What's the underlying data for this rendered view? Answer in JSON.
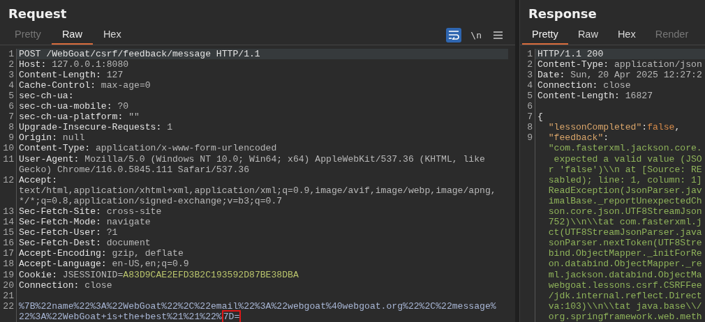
{
  "request": {
    "title": "Request",
    "tabs": [
      {
        "label": "Pretty",
        "selected": false,
        "disabled": true
      },
      {
        "label": "Raw",
        "selected": true,
        "disabled": false
      },
      {
        "label": "Hex",
        "selected": false,
        "disabled": false
      }
    ],
    "toolbar": [
      {
        "kind": "wrap",
        "on": true
      },
      {
        "kind": "newlines",
        "label": "\\n",
        "on": false
      },
      {
        "kind": "menu",
        "on": false
      }
    ],
    "rows": [
      {
        "number": "1",
        "selected": true,
        "segments": [
          {
            "kind": "name",
            "text": "POST /WebGoat/csrf/feedback/message HTTP/1.1"
          }
        ]
      },
      {
        "number": "2",
        "selected": false,
        "segments": [
          {
            "kind": "name",
            "text": "Host:"
          },
          {
            "kind": "value",
            "text": " 127.0.0.1:8080"
          }
        ]
      },
      {
        "number": "3",
        "selected": false,
        "segments": [
          {
            "kind": "name",
            "text": "Content-Length:"
          },
          {
            "kind": "value",
            "text": " 127"
          }
        ]
      },
      {
        "number": "4",
        "selected": false,
        "segments": [
          {
            "kind": "name",
            "text": "Cache-Control:"
          },
          {
            "kind": "value",
            "text": " max-age=0"
          }
        ]
      },
      {
        "number": "5",
        "selected": false,
        "segments": [
          {
            "kind": "name",
            "text": "sec-ch-ua:"
          }
        ]
      },
      {
        "number": "6",
        "selected": false,
        "segments": [
          {
            "kind": "name",
            "text": "sec-ch-ua-mobile:"
          },
          {
            "kind": "value",
            "text": " ?0"
          }
        ]
      },
      {
        "number": "7",
        "selected": false,
        "segments": [
          {
            "kind": "name",
            "text": "sec-ch-ua-platform:"
          },
          {
            "kind": "value",
            "text": " \"\""
          }
        ]
      },
      {
        "number": "8",
        "selected": false,
        "segments": [
          {
            "kind": "name",
            "text": "Upgrade-Insecure-Requests:"
          },
          {
            "kind": "value",
            "text": " 1"
          }
        ]
      },
      {
        "number": "9",
        "selected": false,
        "segments": [
          {
            "kind": "name",
            "text": "Origin:"
          },
          {
            "kind": "value",
            "text": " null"
          }
        ]
      },
      {
        "number": "10",
        "selected": false,
        "segments": [
          {
            "kind": "name",
            "text": "Content-Type:"
          },
          {
            "kind": "value",
            "text": " application/x-www-form-urlencoded"
          }
        ]
      },
      {
        "number": "11",
        "selected": false,
        "segments": [
          {
            "kind": "name",
            "text": "User-Agent:"
          },
          {
            "kind": "value",
            "text": " Mozilla/5.0 (Windows NT 10.0; Win64; x64) AppleWebKit/537.36 (KHTML, like"
          }
        ]
      },
      {
        "selected": false,
        "segments": [
          {
            "kind": "value",
            "text": "Gecko) Chrome/116.0.5845.111 Safari/537.36"
          }
        ]
      },
      {
        "number": "12",
        "selected": false,
        "segments": [
          {
            "kind": "name",
            "text": "Accept:"
          }
        ]
      },
      {
        "selected": false,
        "segments": [
          {
            "kind": "value",
            "text": "text/html,application/xhtml+xml,application/xml;q=0.9,image/avif,image/webp,image/apng,"
          }
        ]
      },
      {
        "selected": false,
        "segments": [
          {
            "kind": "value",
            "text": "*/*;q=0.8,application/signed-exchange;v=b3;q=0.7"
          }
        ]
      },
      {
        "number": "13",
        "selected": false,
        "segments": [
          {
            "kind": "name",
            "text": "Sec-Fetch-Site:"
          },
          {
            "kind": "value",
            "text": " cross-site"
          }
        ]
      },
      {
        "number": "14",
        "selected": false,
        "segments": [
          {
            "kind": "name",
            "text": "Sec-Fetch-Mode:"
          },
          {
            "kind": "value",
            "text": " navigate"
          }
        ]
      },
      {
        "number": "15",
        "selected": false,
        "segments": [
          {
            "kind": "name",
            "text": "Sec-Fetch-User:"
          },
          {
            "kind": "value",
            "text": " ?1"
          }
        ]
      },
      {
        "number": "16",
        "selected": false,
        "segments": [
          {
            "kind": "name",
            "text": "Sec-Fetch-Dest:"
          },
          {
            "kind": "value",
            "text": " document"
          }
        ]
      },
      {
        "number": "17",
        "selected": false,
        "segments": [
          {
            "kind": "name",
            "text": "Accept-Encoding:"
          },
          {
            "kind": "value",
            "text": " gzip, deflate"
          }
        ]
      },
      {
        "number": "18",
        "selected": false,
        "segments": [
          {
            "kind": "name",
            "text": "Accept-Language:"
          },
          {
            "kind": "value",
            "text": " en-US,en;q=0.9"
          }
        ]
      },
      {
        "number": "19",
        "selected": false,
        "segments": [
          {
            "kind": "name",
            "text": "Cookie:"
          },
          {
            "kind": "value",
            "text": " JSESSIONID="
          },
          {
            "kind": "cookie",
            "text": "A83D9CAE2EFD3B2C193592D87BE38DBA"
          }
        ]
      },
      {
        "number": "20",
        "selected": false,
        "segments": [
          {
            "kind": "name",
            "text": "Connection:"
          },
          {
            "kind": "value",
            "text": " close"
          }
        ]
      },
      {
        "number": "21",
        "selected": false,
        "segments": []
      },
      {
        "number": "22",
        "selected": false,
        "segments": [
          {
            "kind": "body",
            "text": "%7B%22name%22%3A%22WebGoat%22%2C%22email%22%3A%22webgoat%40webgoat.org%22%2C%22message%"
          }
        ]
      },
      {
        "selected": false,
        "segments": [
          {
            "kind": "body",
            "text": "22%3A%22WebGoat+is+the+best%21%21%22%"
          },
          {
            "kind": "marked",
            "text": "7D="
          }
        ]
      }
    ]
  },
  "response": {
    "title": "Response",
    "tabs": [
      {
        "label": "Pretty",
        "selected": true,
        "disabled": false
      },
      {
        "label": "Raw",
        "selected": false,
        "disabled": false
      },
      {
        "label": "Hex",
        "selected": false,
        "disabled": false
      },
      {
        "label": "Render",
        "selected": false,
        "disabled": true
      }
    ],
    "rows": [
      {
        "number": "1",
        "selected": true,
        "segments": [
          {
            "kind": "name",
            "text": "HTTP/1.1 200"
          }
        ]
      },
      {
        "number": "2",
        "selected": false,
        "segments": [
          {
            "kind": "name",
            "text": "Content-Type:"
          },
          {
            "kind": "value",
            "text": " application/json"
          }
        ]
      },
      {
        "number": "3",
        "selected": false,
        "segments": [
          {
            "kind": "name",
            "text": "Date:"
          },
          {
            "kind": "value",
            "text": " Sun, 20 Apr 2025 12:27:2"
          }
        ]
      },
      {
        "number": "4",
        "selected": false,
        "segments": [
          {
            "kind": "name",
            "text": "Connection:"
          },
          {
            "kind": "value",
            "text": " close"
          }
        ]
      },
      {
        "number": "5",
        "selected": false,
        "segments": [
          {
            "kind": "name",
            "text": "Content-Length:"
          },
          {
            "kind": "value",
            "text": " 16827"
          }
        ]
      },
      {
        "number": "6",
        "selected": false,
        "segments": []
      },
      {
        "number": "7",
        "selected": false,
        "segments": [
          {
            "kind": "name",
            "text": "{"
          }
        ]
      },
      {
        "number": "8",
        "selected": false,
        "segments": [
          {
            "kind": "key",
            "text": "  \"lessonCompleted\""
          },
          {
            "kind": "name",
            "text": ":"
          },
          {
            "kind": "literal",
            "text": "false"
          },
          {
            "kind": "name",
            "text": ","
          }
        ]
      },
      {
        "number": "9",
        "selected": false,
        "segments": [
          {
            "kind": "key",
            "text": "  \"feedback\""
          },
          {
            "kind": "name",
            "text": ":"
          }
        ]
      },
      {
        "selected": false,
        "segments": [
          {
            "kind": "string",
            "text": "  \"com.fasterxml.jackson.core."
          }
        ]
      },
      {
        "selected": false,
        "segments": [
          {
            "kind": "string",
            "text": "   expected a valid value (JSO"
          }
        ]
      },
      {
        "selected": false,
        "segments": [
          {
            "kind": "string",
            "text": "  r 'false')\\\\n at [Source: RE"
          }
        ]
      },
      {
        "selected": false,
        "segments": [
          {
            "kind": "string",
            "text": "  sabled); line: 1, column: 1]"
          }
        ]
      },
      {
        "selected": false,
        "segments": [
          {
            "kind": "string",
            "text": "  ReadException(JsonParser.jav"
          }
        ]
      },
      {
        "selected": false,
        "segments": [
          {
            "kind": "string",
            "text": "  imalBase._reportUnexpectedCh"
          }
        ]
      },
      {
        "selected": false,
        "segments": [
          {
            "kind": "string",
            "text": "  son.core.json.UTF8StreamJson"
          }
        ]
      },
      {
        "selected": false,
        "segments": [
          {
            "kind": "string",
            "text": "  752)\\\\n\\\\tat com.fasterxml.j"
          }
        ]
      },
      {
        "selected": false,
        "segments": [
          {
            "kind": "string",
            "text": "  ct(UTF8StreamJsonParser.java"
          }
        ]
      },
      {
        "selected": false,
        "segments": [
          {
            "kind": "string",
            "text": "  sonParser.nextToken(UTF8Stre"
          }
        ]
      },
      {
        "selected": false,
        "segments": [
          {
            "kind": "string",
            "text": "  bind.ObjectMapper._initForRe"
          }
        ]
      },
      {
        "selected": false,
        "segments": [
          {
            "kind": "string",
            "text": "  on.databind.ObjectMapper._re"
          }
        ]
      },
      {
        "selected": false,
        "segments": [
          {
            "kind": "string",
            "text": "  ml.jackson.databind.ObjectMa"
          }
        ]
      },
      {
        "selected": false,
        "segments": [
          {
            "kind": "string",
            "text": "  webgoat.lessons.csrf.CSRFFee"
          }
        ]
      },
      {
        "selected": false,
        "segments": [
          {
            "kind": "string",
            "text": "  /jdk.internal.reflect.Direct"
          }
        ]
      },
      {
        "selected": false,
        "segments": [
          {
            "kind": "string",
            "text": "  va:103)\\\\n\\\\tat java.base\\\\/"
          }
        ]
      },
      {
        "selected": false,
        "segments": [
          {
            "kind": "string",
            "text": "  org.springframework.web.meth"
          }
        ]
      }
    ]
  }
}
